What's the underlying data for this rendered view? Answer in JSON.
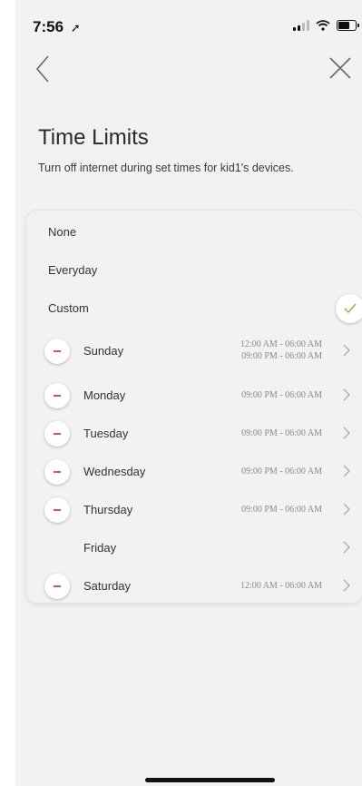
{
  "status_bar": {
    "time": "7:56",
    "location_arrow": "location-arrow-icon"
  },
  "header": {
    "title": "Time Limits",
    "subtitle": "Turn off internet during set times for kid1's devices."
  },
  "options": [
    {
      "label": "None",
      "selected": false
    },
    {
      "label": "Everyday",
      "selected": false
    },
    {
      "label": "Custom",
      "selected": true
    }
  ],
  "schedule": [
    {
      "day": "Sunday",
      "times": [
        "12:00 AM - 06:00 AM",
        "09:00 PM - 06:00 AM"
      ],
      "enabled": true
    },
    {
      "day": "Monday",
      "times": [
        "09:00 PM - 06:00 AM"
      ],
      "enabled": true
    },
    {
      "day": "Tuesday",
      "times": [
        "09:00 PM - 06:00 AM"
      ],
      "enabled": true
    },
    {
      "day": "Wednesday",
      "times": [
        "09:00 PM - 06:00 AM"
      ],
      "enabled": true
    },
    {
      "day": "Thursday",
      "times": [
        "09:00 PM - 06:00 AM"
      ],
      "enabled": true
    },
    {
      "day": "Friday",
      "times": [],
      "enabled": false
    },
    {
      "day": "Saturday",
      "times": [
        "12:00 AM - 06:00 AM"
      ],
      "enabled": true
    }
  ],
  "colors": {
    "accent_check": "#7dbb3a",
    "remove_red": "#e05050",
    "background": "#f3f1f3"
  }
}
